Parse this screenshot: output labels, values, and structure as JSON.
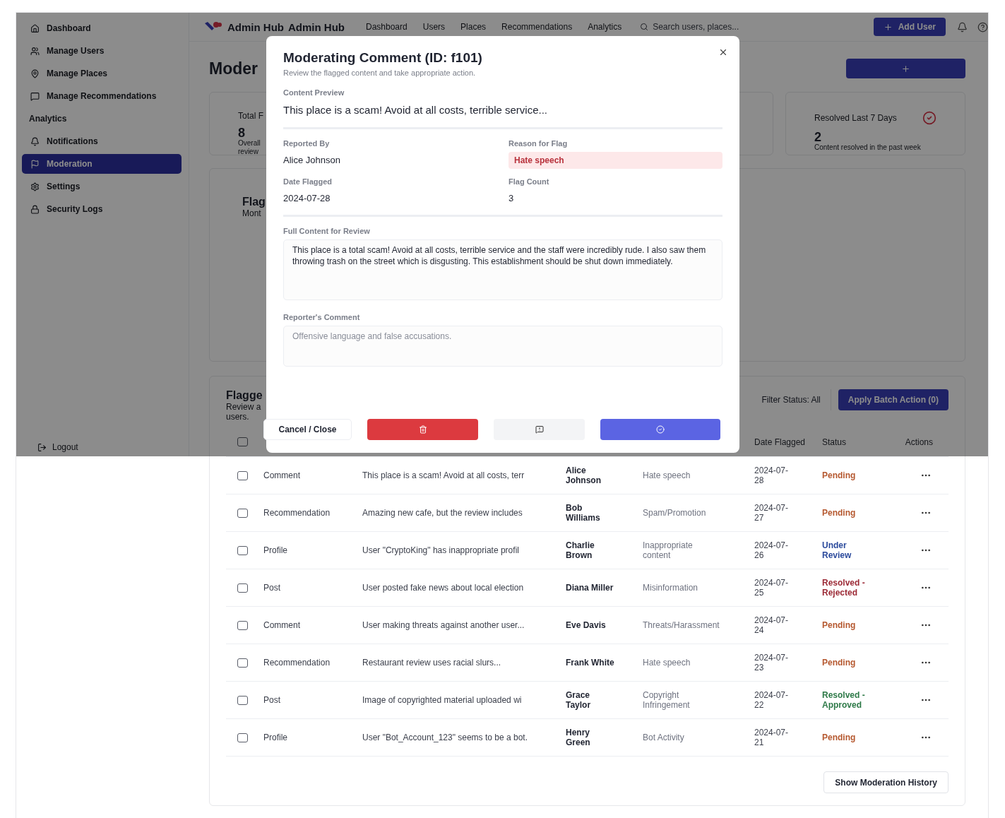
{
  "sidebar": {
    "items": [
      {
        "kind": "link",
        "label": "Dashboard",
        "selected": false
      },
      {
        "kind": "link",
        "label": "Manage Users",
        "selected": false
      },
      {
        "kind": "link",
        "label": "Manage Places",
        "selected": false
      },
      {
        "kind": "link",
        "label": "Manage Recommendations",
        "selected": false
      },
      {
        "kind": "section",
        "label": "Analytics"
      },
      {
        "kind": "link",
        "label": "Notifications",
        "selected": false
      },
      {
        "kind": "link",
        "label": "Moderation",
        "selected": true
      },
      {
        "kind": "link",
        "label": "Settings",
        "selected": false
      },
      {
        "kind": "link",
        "label": "Security Logs",
        "selected": false
      }
    ],
    "logout": "Logout"
  },
  "topbar": {
    "brand": [
      "Admin Hub",
      "Admin Hub"
    ],
    "nav": [
      "Dashboard",
      "Users",
      "Places",
      "Recommendations",
      "Analytics"
    ],
    "search": {
      "placeholder": "Search users, places..."
    },
    "add_button": "Add User"
  },
  "page": {
    "title": "Moder",
    "stats": [
      {
        "label": "Total F",
        "value": "8",
        "description": "Overall review"
      },
      {
        "label": "Resolved Last 7 Days",
        "value": "2",
        "description": "Content resolved in the past week"
      }
    ],
    "chart_card": {
      "title": "Flag",
      "subtitle": "Mont"
    },
    "table_card": {
      "title": "Flagge",
      "subtitle": "Review a users.",
      "filter": "Filter Status: All",
      "batch_button": "Apply Batch Action (0)",
      "select_all": {
        "checked": false
      },
      "columns": [
        "Date Flagged",
        "Status",
        "Actions"
      ],
      "rows": [
        {
          "checked": false,
          "type": "Comment",
          "content": "This place is a scam! Avoid at all costs, terr",
          "reported_by": "Alice Johnson",
          "reason": "Hate speech",
          "date": "2024-07-28",
          "status": "Pending",
          "color": "#b5582f"
        },
        {
          "checked": false,
          "type": "Recommendation",
          "content": "Amazing new cafe, but the review includes",
          "reported_by": "Bob Williams",
          "reason": "Spam/Promotion",
          "date": "2024-07-27",
          "status": "Pending",
          "color": "#b5582f"
        },
        {
          "checked": false,
          "type": "Profile",
          "content": "User \"CryptoKing\" has inappropriate profil",
          "reported_by": "Charlie Brown",
          "reason": "Inappropriate content",
          "date": "2024-07-26",
          "status": "Under Review",
          "color": "#2b4a9c"
        },
        {
          "checked": false,
          "type": "Post",
          "content": "User posted fake news about local election",
          "reported_by": "Diana Miller",
          "reason": "Misinformation",
          "date": "2024-07-25",
          "status": "Resolved - Rejected",
          "color": "#9c2a36"
        },
        {
          "checked": false,
          "type": "Comment",
          "content": "User making threats against another user...",
          "reported_by": "Eve Davis",
          "reason": "Threats/Harassment",
          "date": "2024-07-24",
          "status": "Pending",
          "color": "#b5582f"
        },
        {
          "checked": false,
          "type": "Recommendation",
          "content": "Restaurant review uses racial slurs...",
          "reported_by": "Frank White",
          "reason": "Hate speech",
          "date": "2024-07-23",
          "status": "Pending",
          "color": "#b5582f"
        },
        {
          "checked": false,
          "type": "Post",
          "content": "Image of copyrighted material uploaded wi",
          "reported_by": "Grace Taylor",
          "reason": "Copyright Infringement",
          "date": "2024-07-22",
          "status": "Resolved - Approved",
          "color": "#2e7a48"
        },
        {
          "checked": false,
          "type": "Profile",
          "content": "User \"Bot_Account_123\" seems to be a bot.",
          "reported_by": "Henry Green",
          "reason": "Bot Activity",
          "date": "2024-07-21",
          "status": "Pending",
          "color": "#b5582f"
        }
      ],
      "history_button": "Show Moderation History"
    }
  },
  "modal": {
    "title": "Moderating Comment (ID: f101)",
    "subtitle": "Review the flagged content and take appropriate action.",
    "preview": {
      "label": "Content Preview",
      "value": "This place is a scam! Avoid at all costs, terrible service..."
    },
    "details": [
      {
        "kind": "text",
        "label": "Reported By",
        "value": "Alice Johnson"
      },
      {
        "kind": "badge",
        "label": "Reason for Flag",
        "value": "Hate speech"
      },
      {
        "kind": "text",
        "label": "Date Flagged",
        "value": "2024-07-28"
      },
      {
        "kind": "text",
        "label": "Flag Count",
        "value": "3"
      }
    ],
    "full_content": {
      "label": "Full Content for Review",
      "value": "This place is a total scam! Avoid at all costs, terrible service and the staff were incredibly rude. I also saw them throwing trash on the street which is disgusting. This establishment should be shut down immediately."
    },
    "reporter_comment": {
      "label": "Reporter's Comment",
      "value": "Offensive language and false accusations."
    },
    "cancel_button": "Cancel / Close",
    "actions": [
      {
        "kind": "delete"
      },
      {
        "kind": "comment"
      },
      {
        "kind": "approve"
      }
    ]
  }
}
